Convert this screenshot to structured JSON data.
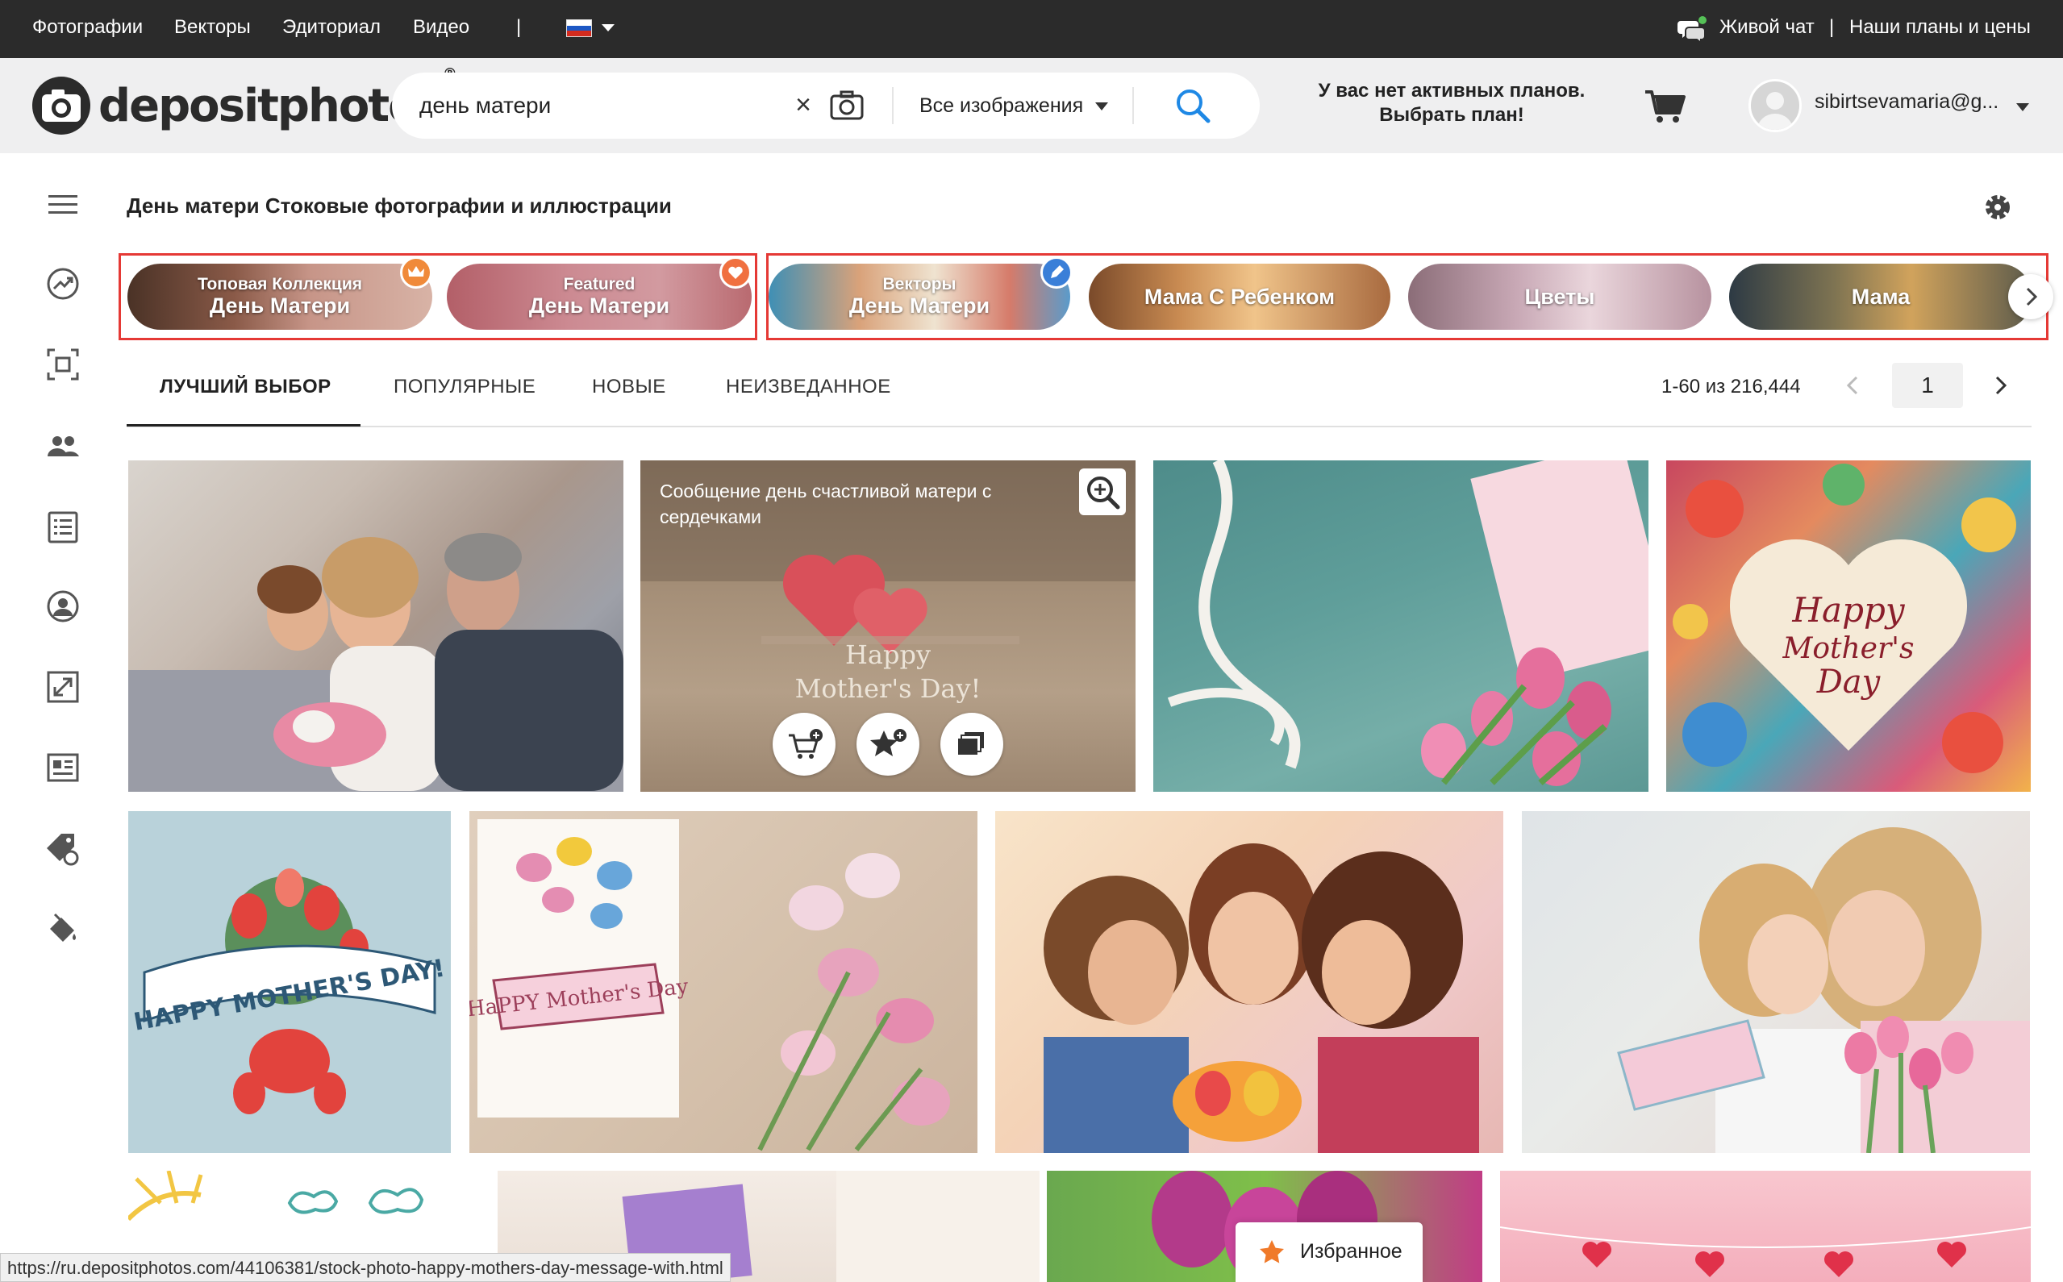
{
  "topbar": {
    "nav": [
      "Фотографии",
      "Векторы",
      "Эдиториал",
      "Видео"
    ],
    "separator": "|",
    "live_chat": "Живой чат",
    "plans": "Наши планы и цены"
  },
  "header": {
    "logo_text": "depositphotos",
    "logo_reg": "®",
    "search_value": "день матери",
    "search_clear": "×",
    "search_filter": "Все изображения",
    "plan_line1": "У вас нет активных планов.",
    "plan_line2": "Выбрать план!",
    "user_email": "sibirtsevamaria@g..."
  },
  "page": {
    "title": "День матери Стоковые фотографии и иллюстрации"
  },
  "chips": [
    {
      "line1": "Топовая Коллекция",
      "line2": "День Матери",
      "badge": "crown-icon",
      "badge_color": "#f08a3a"
    },
    {
      "line1": "Featured",
      "line2": "День Матери",
      "badge": "heart-icon",
      "badge_color": "#f07040"
    },
    {
      "line1": "Векторы",
      "line2": "День Матери",
      "badge": "pen-icon",
      "badge_color": "#3a7fd8"
    },
    {
      "label": "Мама С Ребенком"
    },
    {
      "label": "Цветы"
    },
    {
      "label": "Мама"
    }
  ],
  "tabs": [
    "ЛУЧШИЙ ВЫБОР",
    "ПОПУЛЯРНЫЕ",
    "НОВЫЕ",
    "НЕИЗВЕДАННОЕ"
  ],
  "pager": {
    "range": "1-60 из 216,444",
    "page": "1"
  },
  "grid": {
    "hover_caption": "Сообщение день счастливой матери с сердечками",
    "card_text": [
      "Happy",
      "Mother's Day!"
    ],
    "row2_text": [
      "HAPPY MOTHER'S DAY!",
      "HaPPY Mother's Day"
    ]
  },
  "footer": {
    "status_url": "https://ru.depositphotos.com/44106381/stock-photo-happy-mothers-day-message-with.html",
    "favorites": "Избранное"
  },
  "colors": {
    "topbar": "#2b2b2b",
    "header_bg": "#efeff0",
    "accent_blue": "#1e88e5",
    "highlight_red": "#e53935"
  }
}
